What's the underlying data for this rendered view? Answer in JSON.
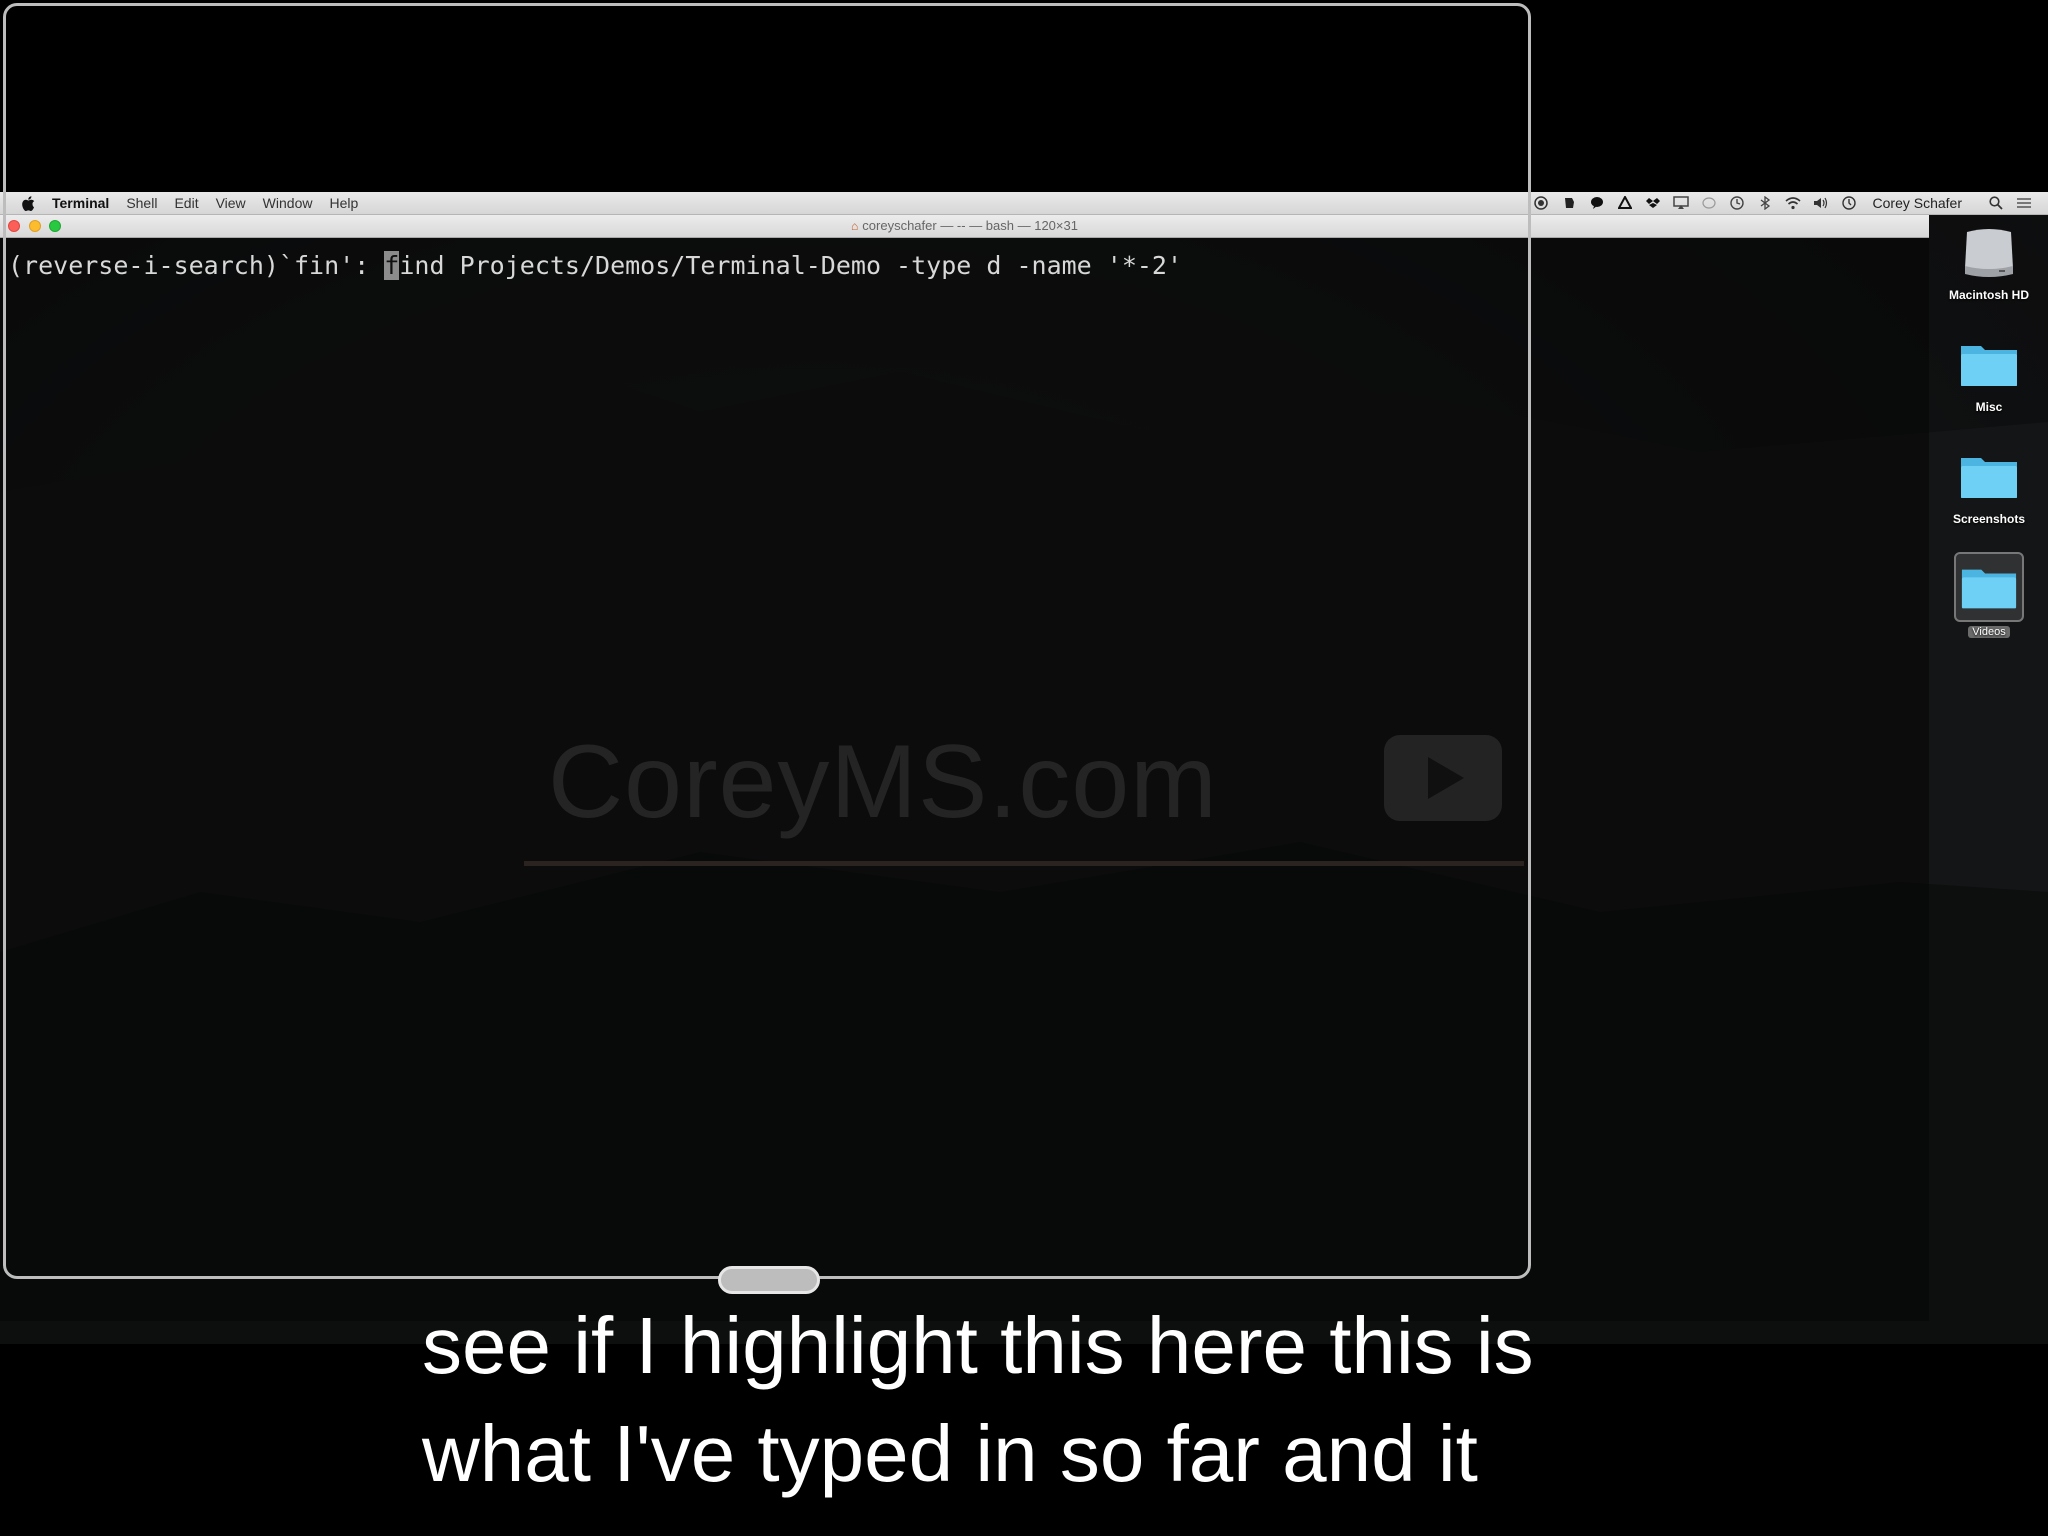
{
  "menubar": {
    "app_name": "Terminal",
    "items": [
      "Shell",
      "Edit",
      "View",
      "Window",
      "Help"
    ],
    "user_name": "Corey Schafer"
  },
  "terminal": {
    "window_title": "coreyschafer — -- — bash — 120×31",
    "prompt_prefix": "(reverse-i-search)`fin': ",
    "cursor_char": "f",
    "command_rest": "ind Projects/Demos/Terminal-Demo -type d -name '*-2'"
  },
  "desktop": {
    "icons": [
      {
        "label": "Macintosh HD",
        "icon": "hard-drive-icon"
      },
      {
        "label": "Misc",
        "icon": "folder-icon"
      },
      {
        "label": "Screenshots",
        "icon": "folder-icon"
      },
      {
        "label": "Videos",
        "icon": "folder-icon"
      }
    ]
  },
  "watermark": {
    "text": "CoreyMS.com"
  },
  "caption": {
    "line1": "see if I highlight this here this is",
    "line2": "what I've typed in so far and it"
  },
  "colors": {
    "folder": "#5fc8f0",
    "close": "#fc5f57",
    "minimize": "#fdbc2e",
    "maximize": "#28c840"
  }
}
